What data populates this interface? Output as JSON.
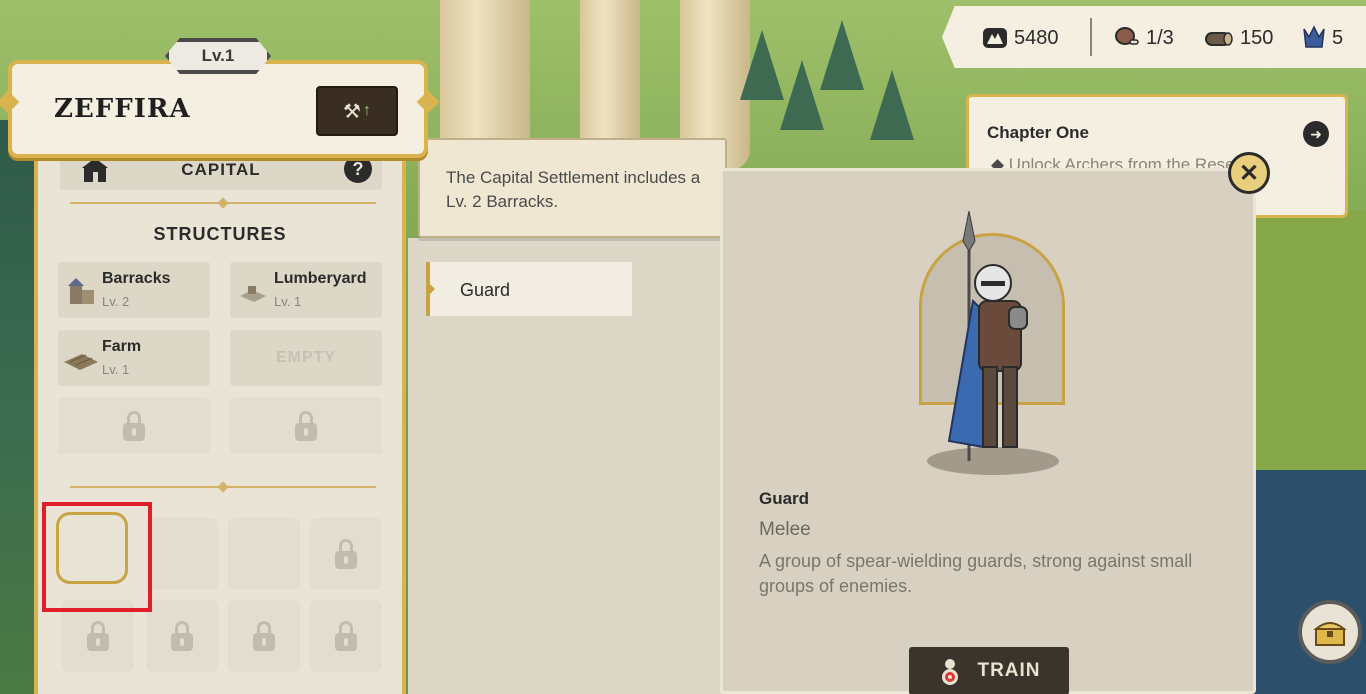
{
  "player": {
    "level": "Lv.1",
    "name": "ZEFFIRA"
  },
  "settlement": {
    "type": "CAPITAL",
    "help_symbol": "?",
    "structures_title": "STRUCTURES",
    "structures": [
      {
        "name": "Barracks",
        "level": "Lv. 2"
      },
      {
        "name": "Lumberyard",
        "level": "Lv. 1"
      },
      {
        "name": "Farm",
        "level": "Lv. 1"
      }
    ],
    "empty_slot_label": "EMPTY"
  },
  "tooltip": {
    "text": "The Capital Settlement includes a Lv. 2 Barracks."
  },
  "unit_list": {
    "items": [
      "Guard"
    ]
  },
  "resources": {
    "stone": "5480",
    "food": "1/3",
    "wood": "150",
    "army": "5"
  },
  "quest": {
    "title": "Chapter One",
    "text": "Unlock Archers from the Research"
  },
  "unit_detail": {
    "name": "Guard",
    "type": "Melee",
    "description": "A group of spear-wielding guards, strong against small groups of enemies.",
    "train_label": "TRAIN",
    "close_symbol": "✕"
  },
  "colors": {
    "gold_accent": "#d9b34e",
    "panel_bg": "#eae4d6",
    "highlight_red": "#e01f2a",
    "button_dark": "#3a342d"
  }
}
